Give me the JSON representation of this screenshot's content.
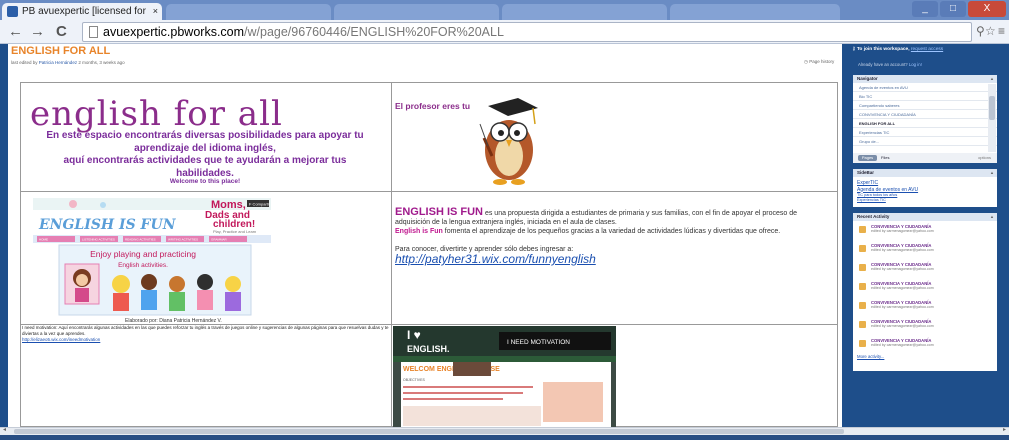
{
  "browser": {
    "tab_title": "PB avuexpertic [licensed for",
    "tab_close": "×",
    "url_host": "avuexpertic.pbworks.com",
    "url_path": "/w/page/96760446/ENGLISH%20FOR%20ALL",
    "back": "←",
    "forward": "→",
    "reload": "C",
    "toolbar_icons": [
      "search-icon",
      "translate-icon",
      "star-icon",
      "menu-icon"
    ],
    "window_controls": {
      "minimize": "_",
      "maximize": "□",
      "close": "X"
    }
  },
  "page": {
    "title": "ENGLISH FOR ALL",
    "edited_prefix": "last edited by",
    "edited_user": "Patricia Hernández",
    "edited_when": "2 months, 3 weeks ago",
    "page_history": "Page history"
  },
  "cell1": {
    "heading": "english for all",
    "line1": "En este espacio encontrarás diversas posibilidades para apoyar tu",
    "line2": "aprendizaje del idioma inglés,",
    "line3": "aquí encontrarás actividades  que te ayudarán a mejorar tus",
    "line4": "habilidades.",
    "welcome": "Welcome to this place!"
  },
  "cell2": {
    "caption": "El profesor eres tu"
  },
  "fun_image": {
    "banner": "ENGLISH IS FUN",
    "moms": "Moms,",
    "dads": "Dads and",
    "children": "children!",
    "play": "Play, Practice and Learn",
    "tagline1": "Enjoy  playing and practicing",
    "tagline2": "English activities.",
    "nav": [
      "HOME",
      "LISTENING ACTIVITIES",
      "READING ACTIVITIES",
      "WRITING ACTIVITIES",
      "GRAMMAR"
    ],
    "badge": "F Compartir"
  },
  "credit": "Elaborado por: Diana Patricia Hernández V.",
  "cell3": {
    "text": "I need motivation: Aquí encontrarás algunas actividades en las que puedes reforzar tu inglés a través de juegos online y sugerencias de algunas páginas para que resuelvas dudas y te diviertas a la vez que aprendes.",
    "link": "http://elizaeo5.wix.com/ineedmotivation"
  },
  "cell4": {
    "lead": "ENGLISH IS FUN",
    "p1": " es una propuesta dirigida a estudiantes  de primaria  y sus familias, con el fin de apoyar el proceso de adquisición de la lengua extranjera inglés, iniciada en el aula de clases.",
    "lead2": "English is Fun",
    "p2": "  fomenta el aprendizaje de los pequeños gracias a la variedad de actividades lúdicas y divertidas que ofrece.",
    "p3": "Para conocer, divertirte y aprender sólo debes ingresar a:",
    "link": "http://patyher31.wix.com/funnyenglish"
  },
  "motivation_image": {
    "heart": "I ♥",
    "english": "ENGLISH.",
    "need": "I NEED MOTIVATION",
    "welcome": "WELCOM      ENGLISH COURSE",
    "objectives": "OBJECTIVES"
  },
  "sidebar": {
    "join_prefix": "To join this workspace,",
    "join_link": "request access",
    "already": "Already have an account?",
    "login": "Log in!",
    "navigator": {
      "title": "Navigator",
      "items": [
        "Agenda de eventos en AVU",
        "Bio TIC",
        "Compartiendo saberes",
        "CONVIVENCIA Y CIUDADANÍA",
        "ENGLISH FOR ALL",
        "Experiencias TIC",
        "Grupo de..."
      ],
      "selected_index": 4,
      "pages": "Pages",
      "files": "Files",
      "options": "options"
    },
    "sidebar_panel": {
      "title": "SideBar",
      "links": [
        "ExperTIC",
        "Agenda de eventos en AVU"
      ],
      "small_links": [
        "TIC para todos los años",
        "Experiencias TIC"
      ]
    },
    "recent": {
      "title": "Recent Activity",
      "items": [
        {
          "title": "CONVIVENCIA Y CIUDADANÍA",
          "sub": "edited by carmenagomezr@yahoo.com"
        },
        {
          "title": "CONVIVENCIA Y CIUDADANÍA",
          "sub": "edited by carmenagomezr@yahoo.com"
        },
        {
          "title": "CONVIVENCIA Y CIUDADANÍA",
          "sub": "edited by carmenagomezr@yahoo.com"
        },
        {
          "title": "CONVIVENCIA Y CIUDADANÍA",
          "sub": "edited by carmenagomezr@yahoo.com"
        },
        {
          "title": "CONVIVENCIA Y CIUDADANÍA",
          "sub": "edited by carmenagomezr@yahoo.com"
        },
        {
          "title": "CONVIVENCIA Y CIUDADANÍA",
          "sub": "edited by carmenagomezr@yahoo.com"
        },
        {
          "title": "CONVIVENCIA Y CIUDADANÍA",
          "sub": "edited by carmenagomezr@yahoo.com"
        }
      ],
      "more": "More activity..."
    }
  },
  "scrollbar": {
    "left": "◂",
    "right": "▸"
  },
  "colors": {
    "accent": "#e8842a",
    "purple": "#8b2d8b",
    "sidebar": "#1e4e8a",
    "link": "#1a4fb0"
  }
}
